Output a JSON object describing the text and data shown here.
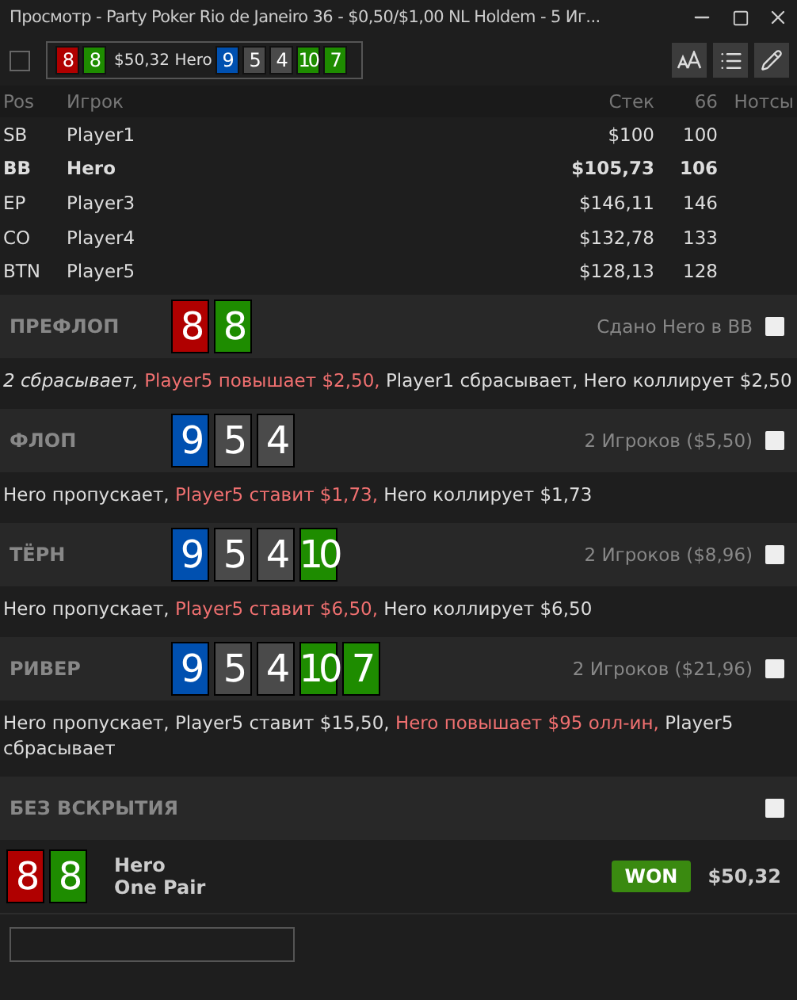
{
  "window": {
    "title": "Просмотр - Party Poker Rio de Janeiro 36 - $0,50/$1,00 NL Holdem - 5 Иг..."
  },
  "toolbar": {
    "checked": false,
    "hand_cards": [
      {
        "rank": "8",
        "color": "#b00000"
      },
      {
        "rank": "8",
        "color": "#1e8c00"
      }
    ],
    "amount": "$50,32",
    "player": "Hero",
    "board": [
      {
        "rank": "9",
        "color": "#0050b0"
      },
      {
        "rank": "5",
        "color": "#4a4a4a"
      },
      {
        "rank": "4",
        "color": "#4a4a4a"
      },
      {
        "rank": "10",
        "color": "#1e8c00"
      },
      {
        "rank": "7",
        "color": "#1e8c00"
      }
    ],
    "buttons": [
      {
        "kind": "font"
      },
      {
        "kind": "list"
      },
      {
        "kind": "edit"
      }
    ]
  },
  "table": {
    "columns": [
      "Pos",
      "Игрок",
      "Стек",
      "66",
      "Нотсы"
    ],
    "rows": [
      {
        "pos": "SB",
        "player": "Player1",
        "stack": "$100",
        "bb": "100",
        "hero": false
      },
      {
        "pos": "BB",
        "player": "Hero",
        "stack": "$105,73",
        "bb": "106",
        "hero": true
      },
      {
        "pos": "EP",
        "player": "Player3",
        "stack": "$146,11",
        "bb": "146",
        "hero": false
      },
      {
        "pos": "CO",
        "player": "Player4",
        "stack": "$132,78",
        "bb": "133",
        "hero": false
      },
      {
        "pos": "BTN",
        "player": "Player5",
        "stack": "$128,13",
        "bb": "128",
        "hero": false
      }
    ]
  },
  "streets": [
    {
      "name": "ПРЕФЛОП",
      "cards": [
        {
          "rank": "8",
          "color": "#b00000"
        },
        {
          "rank": "8",
          "color": "#1e8c00"
        }
      ],
      "info": "Сдано Hero в BB",
      "actions": [
        {
          "text": "2 сбрасывает,",
          "kind": "italic"
        },
        {
          "text": "Player5 повышает $2,50,",
          "kind": "highlight"
        },
        {
          "text": "Player1 сбрасывает, Hero коллирует $2,50",
          "kind": "normal"
        }
      ]
    },
    {
      "name": "ФЛОП",
      "cards": [
        {
          "rank": "9",
          "color": "#0050b0"
        },
        {
          "rank": "5",
          "color": "#4a4a4a"
        },
        {
          "rank": "4",
          "color": "#4a4a4a"
        }
      ],
      "info": "2 Игроков ($5,50)",
      "actions": [
        {
          "text": "Hero пропускает,",
          "kind": "normal"
        },
        {
          "text": "Player5 ставит $1,73,",
          "kind": "highlight"
        },
        {
          "text": "Hero коллирует $1,73",
          "kind": "normal"
        }
      ]
    },
    {
      "name": "ТЁРН",
      "cards": [
        {
          "rank": "9",
          "color": "#0050b0"
        },
        {
          "rank": "5",
          "color": "#4a4a4a"
        },
        {
          "rank": "4",
          "color": "#4a4a4a"
        },
        {
          "rank": "10",
          "color": "#1e8c00"
        }
      ],
      "info": "2 Игроков ($8,96)",
      "actions": [
        {
          "text": "Hero пропускает,",
          "kind": "normal"
        },
        {
          "text": "Player5 ставит $6,50,",
          "kind": "highlight"
        },
        {
          "text": "Hero коллирует $6,50",
          "kind": "normal"
        }
      ]
    },
    {
      "name": "РИВЕР",
      "cards": [
        {
          "rank": "9",
          "color": "#0050b0"
        },
        {
          "rank": "5",
          "color": "#4a4a4a"
        },
        {
          "rank": "4",
          "color": "#4a4a4a"
        },
        {
          "rank": "10",
          "color": "#1e8c00"
        },
        {
          "rank": "7",
          "color": "#1e8c00"
        }
      ],
      "info": "2 Игроков ($21,96)",
      "actions": [
        {
          "text": "Hero пропускает, Player5 ставит $15,50,",
          "kind": "normal"
        },
        {
          "text": "Hero повышает $95 олл-ин,",
          "kind": "highlight"
        },
        {
          "text": "Player5 сбрасывает",
          "kind": "normal"
        }
      ]
    }
  ],
  "showdown": {
    "name": "БЕЗ ВСКРЫТИЯ",
    "cards": [
      {
        "rank": "8",
        "color": "#b00000"
      },
      {
        "rank": "8",
        "color": "#1e8c00"
      }
    ],
    "player": "Hero",
    "hand": "One Pair",
    "result": "WON",
    "amount": "$50,32"
  }
}
